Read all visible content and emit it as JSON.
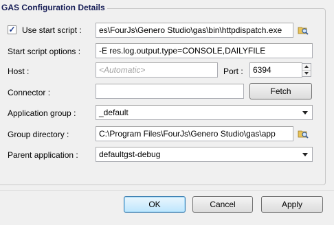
{
  "group": {
    "title": "GAS Configuration Details"
  },
  "use_start_script": {
    "checked": true,
    "label": "Use start script :",
    "value": "es\\FourJs\\Genero Studio\\gas\\bin\\httpdispatch.exe"
  },
  "start_script_options": {
    "label": "Start script options :",
    "value": "-E res.log.output.type=CONSOLE,DAILYFILE"
  },
  "host": {
    "label": "Host :",
    "placeholder": "<Automatic>"
  },
  "port": {
    "label": "Port :",
    "value": "6394"
  },
  "connector": {
    "label": "Connector :",
    "value": "",
    "fetch_label": "Fetch"
  },
  "application_group": {
    "label": "Application group :",
    "value": "_default"
  },
  "group_directory": {
    "label": "Group directory :",
    "value": "C:\\Program Files\\FourJs\\Genero Studio\\gas\\app"
  },
  "parent_application": {
    "label": "Parent application :",
    "value": "defaultgst-debug"
  },
  "buttons": {
    "ok": "OK",
    "cancel": "Cancel",
    "apply": "Apply"
  },
  "icons": {
    "browse": "folder-search-icon",
    "check": "checkmark-icon"
  }
}
